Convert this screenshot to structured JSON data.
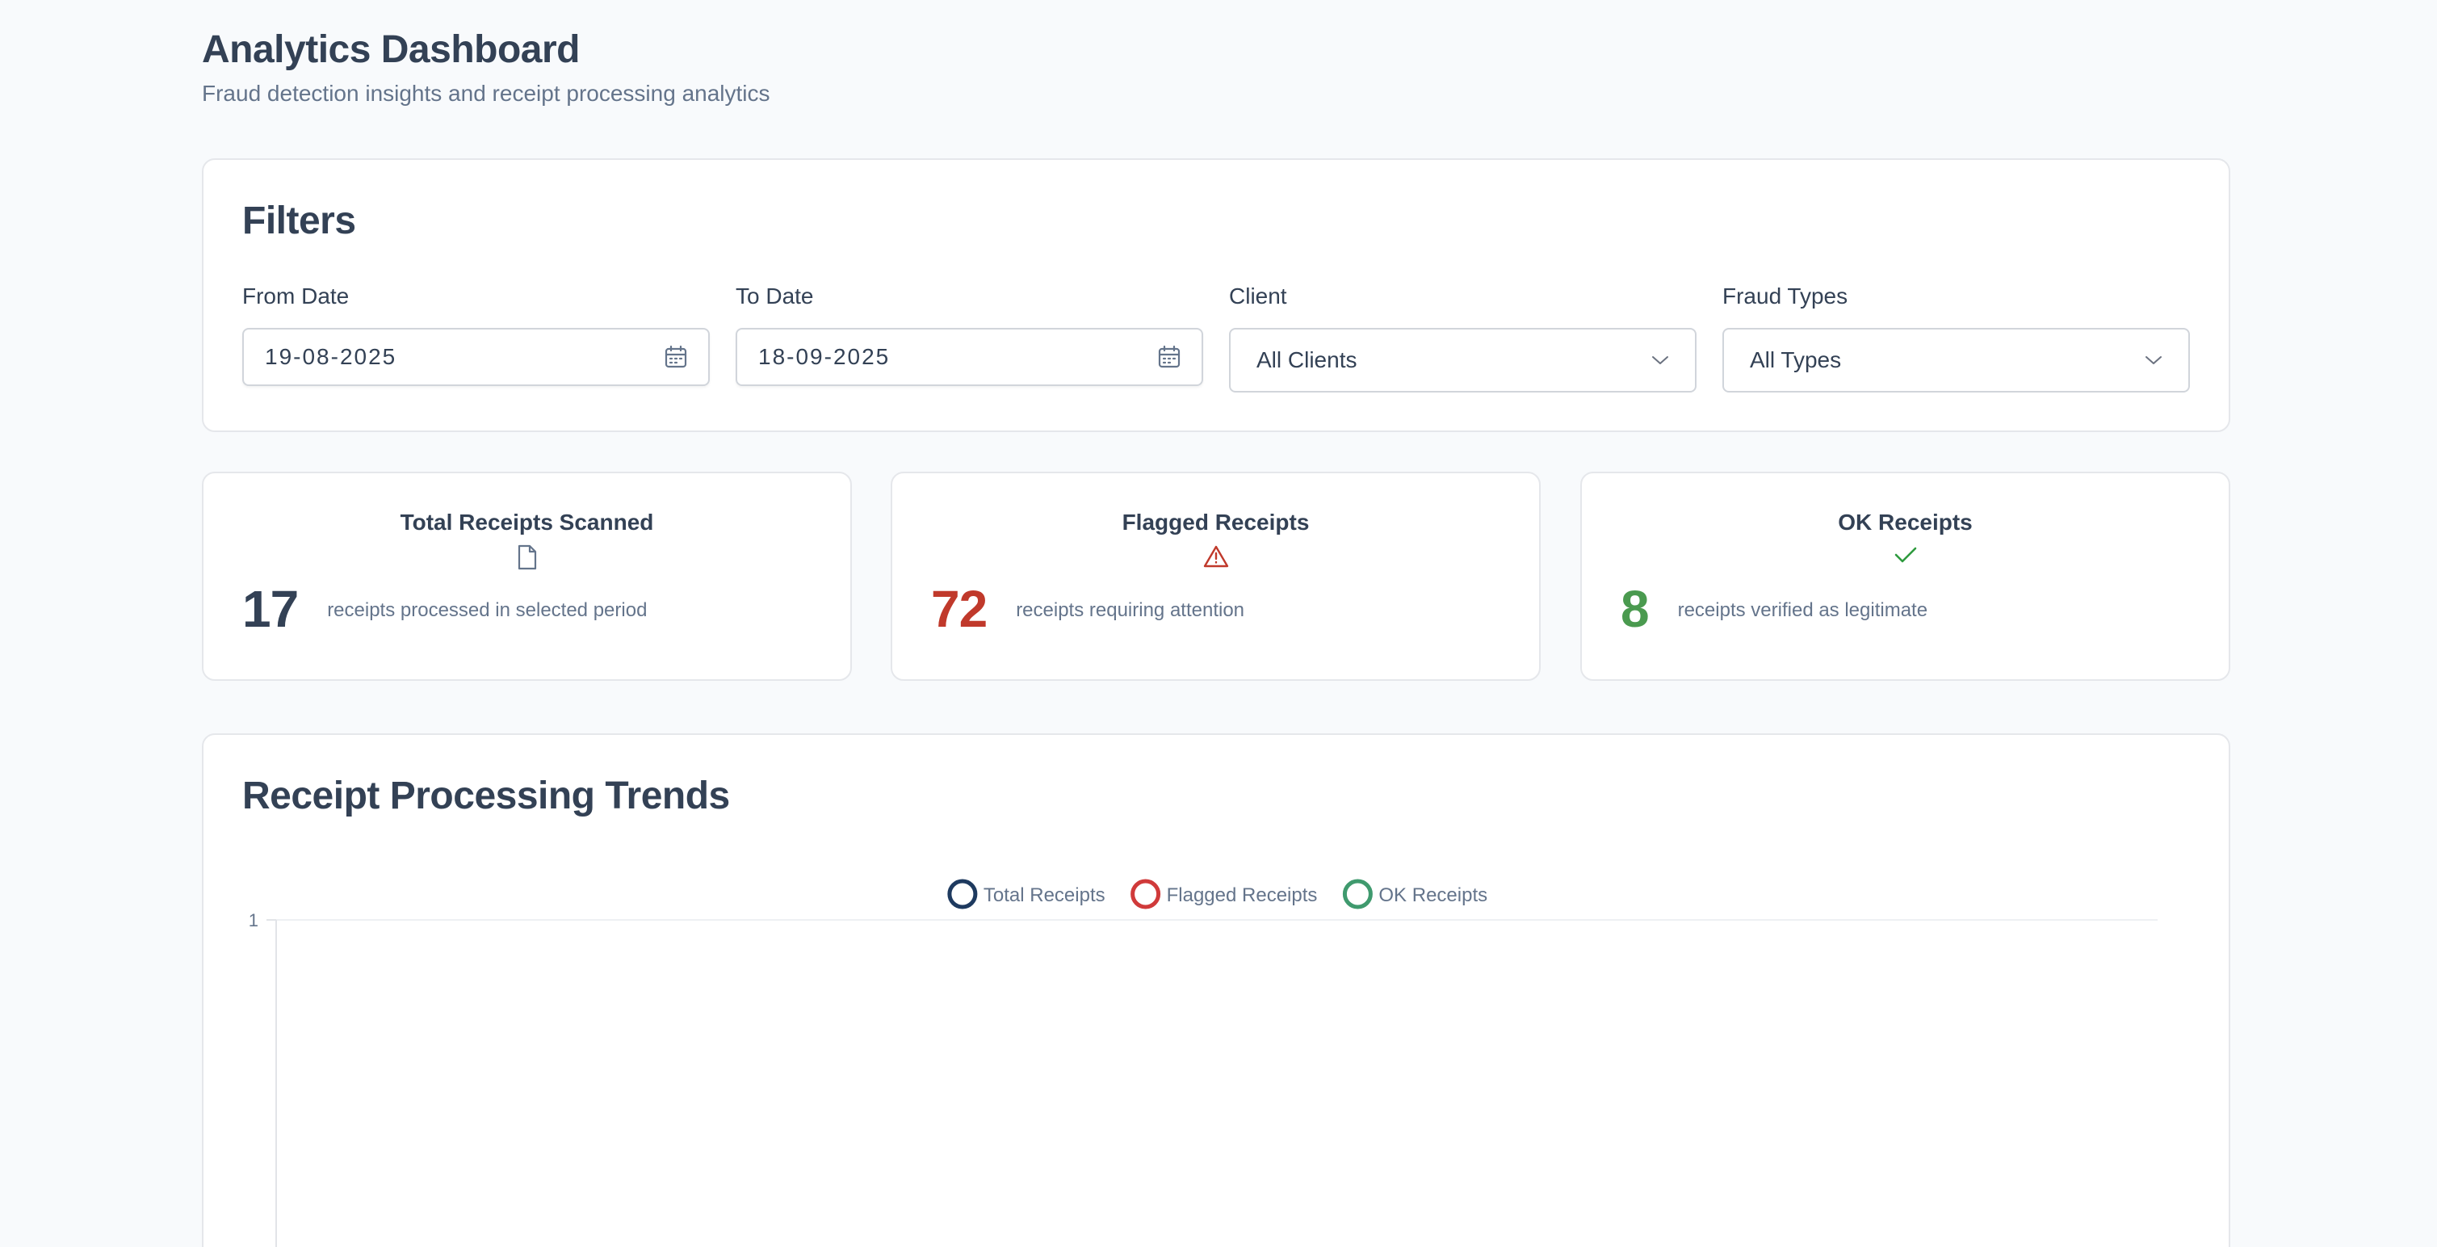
{
  "header": {
    "title": "Analytics Dashboard",
    "subtitle": "Fraud detection insights and receipt processing analytics"
  },
  "filters": {
    "title": "Filters",
    "from_date": {
      "label": "From Date",
      "value": "19-08-2025"
    },
    "to_date": {
      "label": "To Date",
      "value": "18-09-2025"
    },
    "client": {
      "label": "Client",
      "value": "All Clients"
    },
    "fraud_types": {
      "label": "Fraud Types",
      "value": "All Types"
    }
  },
  "stats": {
    "total": {
      "title": "Total Receipts Scanned",
      "value": "17",
      "desc": "receipts processed in selected period",
      "icon": "document-icon",
      "color": "#334155"
    },
    "flagged": {
      "title": "Flagged Receipts",
      "value": "72",
      "desc": "receipts requiring attention",
      "icon": "warning-icon",
      "color": "#c0392b"
    },
    "ok": {
      "title": "OK Receipts",
      "value": "8",
      "desc": "receipts verified as legitimate",
      "icon": "check-icon",
      "color": "#4a9a4f"
    }
  },
  "chart": {
    "title": "Receipt Processing Trends"
  },
  "chart_data": {
    "type": "line",
    "x": [],
    "series": [
      {
        "name": "Total Receipts",
        "color": "#1e3a5f",
        "values": []
      },
      {
        "name": "Flagged Receipts",
        "color": "#d03a3a",
        "values": []
      },
      {
        "name": "OK Receipts",
        "color": "#3f9a6e",
        "values": []
      }
    ],
    "yticks": [
      "1"
    ],
    "legend": "top-center",
    "grid": true
  }
}
